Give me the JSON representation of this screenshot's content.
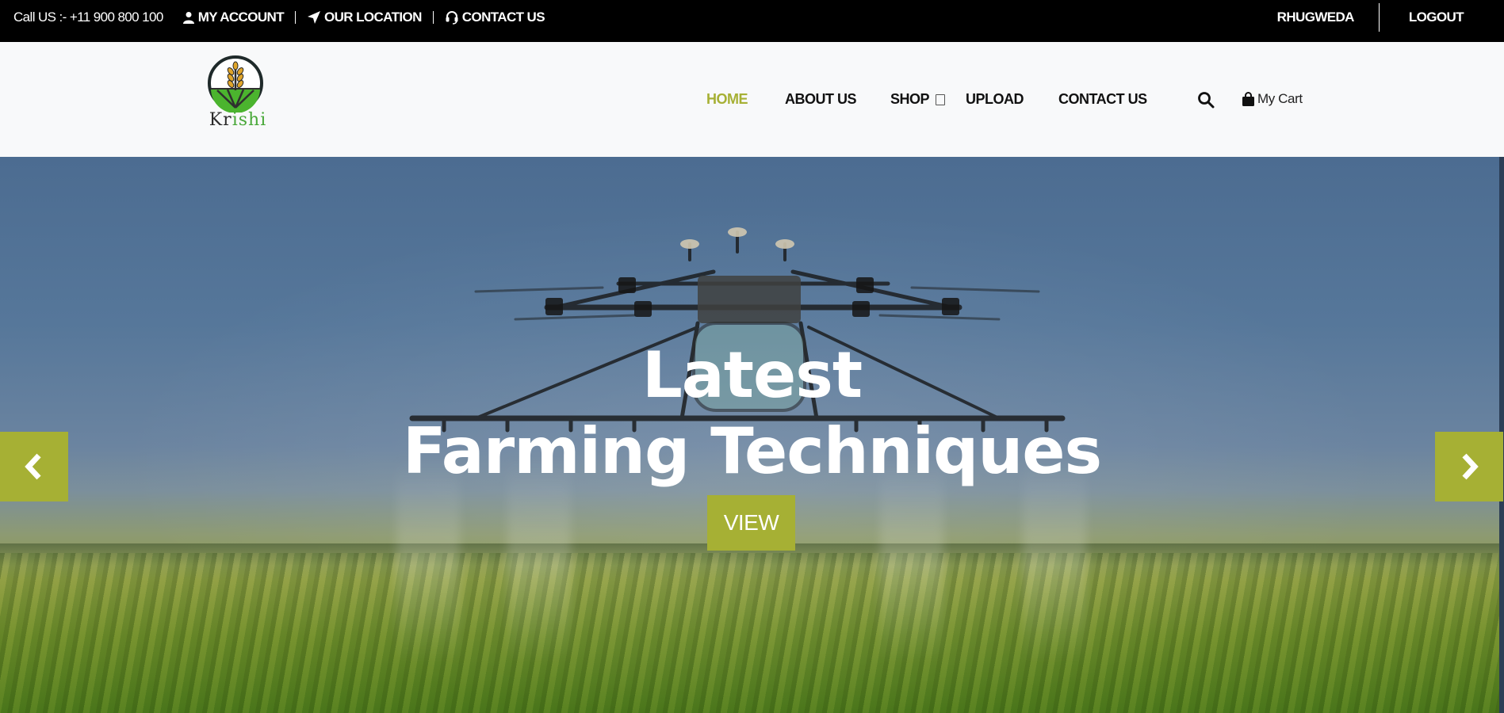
{
  "topbar": {
    "phone": "Call US :- +11 900 800 100",
    "my_account": "MY ACCOUNT",
    "our_location": "OUR LOCATION",
    "contact_us": "CONTACT US",
    "username": "RHUGWEDA",
    "logout": "LOGOUT"
  },
  "logo": {
    "text_a": "Kr",
    "text_b": "ishi"
  },
  "nav": {
    "home": "HOME",
    "about": "ABOUT US",
    "shop": "SHOP",
    "upload": "UPLOAD",
    "contact": "CONTACT US",
    "cart": "My Cart"
  },
  "hero": {
    "line1": "Latest",
    "line2": "Farming Techniques",
    "button": "VIEW"
  },
  "colors": {
    "accent": "#a6b034",
    "topbar_bg": "#000000",
    "header_bg": "#f8f9fa"
  },
  "icons": {
    "my_account": "user-icon",
    "our_location": "location-arrow-icon",
    "contact_us": "headset-icon",
    "search": "search-icon",
    "cart": "shopping-bag-icon",
    "prev": "chevron-left-icon",
    "next": "chevron-right-icon",
    "shop_dropdown": "dropdown-icon"
  }
}
